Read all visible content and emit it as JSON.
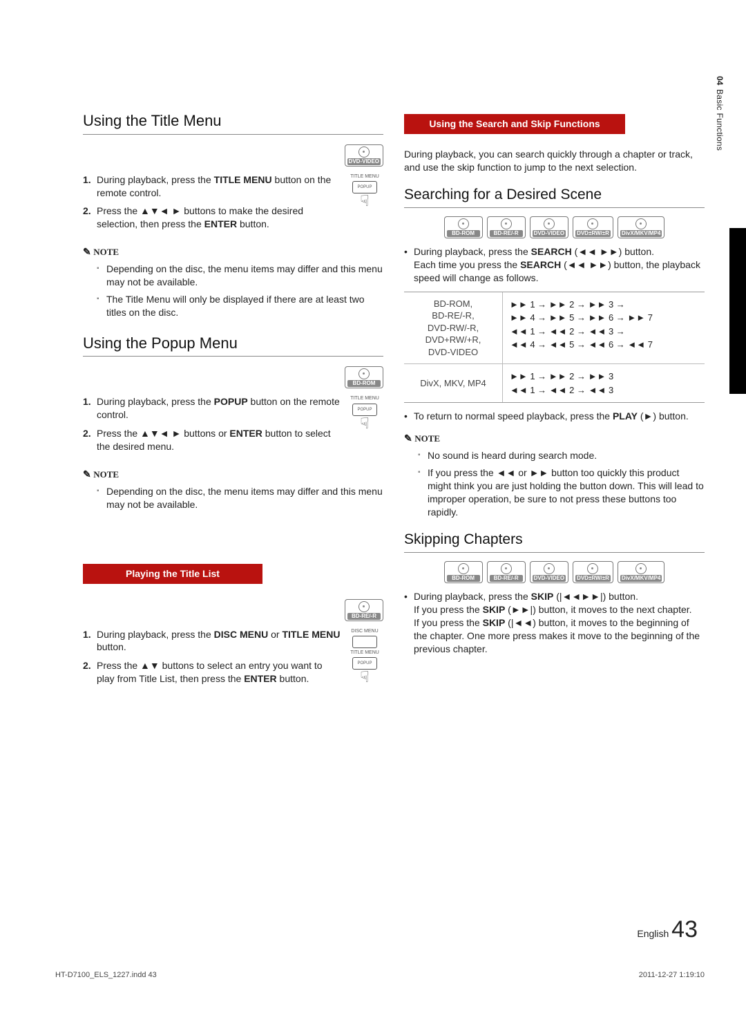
{
  "sidetab": {
    "num": "04",
    "label": "Basic Functions"
  },
  "left": {
    "title_menu": {
      "heading": "Using the Title Menu",
      "badge": "DVD-VIDEO",
      "remote": {
        "l1": "TITLE MENU",
        "l2": "POPUP"
      },
      "step1_a": "During playback, press the ",
      "step1_b": "TITLE MENU",
      "step1_c": " button on the remote control.",
      "step2_a": "Press the ",
      "step2_arrows": "▲▼◄ ►",
      "step2_b": " buttons to make the desired selection, then press the ",
      "step2_c": "ENTER",
      "step2_d": " button.",
      "note_label": "NOTE",
      "note1": "Depending on the disc, the menu items may differ and this menu may not be available.",
      "note2": "The Title Menu will only be displayed if there are at least two titles on the disc."
    },
    "popup_menu": {
      "heading": "Using the Popup Menu",
      "badge": "BD-ROM",
      "remote": {
        "l1": "TITLE MENU",
        "l2": "POPUP"
      },
      "step1_a": "During playback, press the ",
      "step1_b": "POPUP",
      "step1_c": " button on the remote control.",
      "step2_a": "Press the ",
      "step2_arrows": "▲▼◄ ►",
      "step2_b": " buttons or ",
      "step2_c": "ENTER",
      "step2_d": " button to select the desired menu.",
      "note_label": "NOTE",
      "note1": "Depending on the disc, the menu items may differ and this menu may not be available."
    },
    "title_list": {
      "bar": "Playing the Title List",
      "badge": "BD-RE/-R",
      "remote": {
        "l1": "DISC MENU",
        "l2": "TITLE MENU",
        "l3": "POPUP"
      },
      "step1_a": "During playback, press the ",
      "step1_b": "DISC MENU",
      "step1_c": " or ",
      "step1_d": "TITLE MENU",
      "step1_e": " button.",
      "step2_a": "Press the ",
      "step2_arrows": "▲▼",
      "step2_b": " buttons to select an entry you want to play from Title List, then press the ",
      "step2_c": "ENTER",
      "step2_d": " button."
    }
  },
  "right": {
    "search_skip": {
      "bar": "Using the Search and Skip Functions",
      "intro": "During playback, you can search quickly through a chapter or track, and use the skip function to jump to the next selection."
    },
    "searching": {
      "heading": "Searching for a Desired Scene",
      "badges": [
        "BD-ROM",
        "BD-RE/-R",
        "DVD-VIDEO",
        "DVD±RW/±R",
        "DivX/MKV/MP4"
      ],
      "bul1_a": "During playback, press the ",
      "bul1_b": "SEARCH",
      "bul1_c": " (",
      "bul1_sym": "◄◄ ►►",
      "bul1_d": ") button.",
      "bul1_e": "Each time you press the ",
      "bul1_f": "SEARCH",
      "bul1_g": " (",
      "bul1_sym2": "◄◄ ►►",
      "bul1_h": ") button, the playback speed will change as follows.",
      "table": {
        "r1_media": "BD-ROM,\nBD-RE/-R,\nDVD-RW/-R,\nDVD+RW/+R,\nDVD-VIDEO",
        "r1_speeds": "►► 1 → ►► 2 → ►► 3 →\n►► 4 → ►► 5 → ►► 6 → ►► 7\n◄◄ 1 → ◄◄ 2 → ◄◄ 3 →\n◄◄ 4 → ◄◄ 5 → ◄◄ 6 → ◄◄ 7",
        "r2_media": "DivX, MKV, MP4",
        "r2_speeds": "►► 1 → ►► 2 → ►► 3\n◄◄ 1 → ◄◄ 2 → ◄◄ 3"
      },
      "bul2_a": "To return to normal speed playback, press the ",
      "bul2_b": "PLAY",
      "bul2_c": " (►) button.",
      "note_label": "NOTE",
      "note1": "No sound is heard during search mode.",
      "note2_a": "If you press the ",
      "note2_sym1": "◄◄",
      "note2_b": " or ",
      "note2_sym2": "►►",
      "note2_c": " button too quickly this product might think you are just holding the button down.  This will lead to improper operation, be sure to not press these buttons too rapidly."
    },
    "skipping": {
      "heading": "Skipping Chapters",
      "badges": [
        "BD-ROM",
        "BD-RE/-R",
        "DVD-VIDEO",
        "DVD±RW/±R",
        "DivX/MKV/MP4"
      ],
      "bul1_a": "During playback, press the ",
      "bul1_b": "SKIP",
      "bul1_c": " (",
      "bul1_sym": "|◄◄►►|",
      "bul1_d": ") button.",
      "bul1_e": "If you press the ",
      "bul1_f": "SKIP",
      "bul1_g": " (►►|) button, it moves to the next chapter.",
      "bul1_h": "If you press the ",
      "bul1_i": "SKIP",
      "bul1_j": " (|◄◄) button, it moves to the beginning of the chapter. One more press makes it move to the beginning of the previous chapter."
    }
  },
  "footer": {
    "lang": "English",
    "page": "43",
    "file": "HT-D7100_ELS_1227.indd   43",
    "date": "2011-12-27   1:19:10"
  }
}
